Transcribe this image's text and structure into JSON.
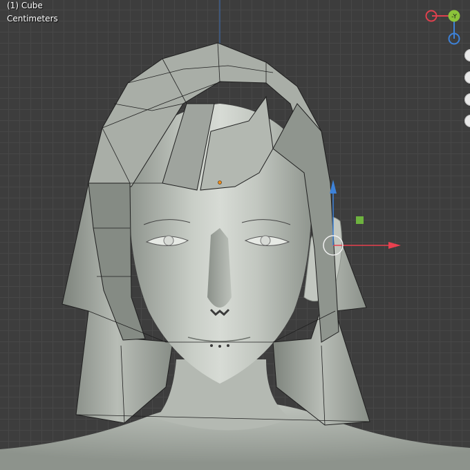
{
  "viewport": {
    "object_label": "(1) Cube",
    "units_label": "Centimeters"
  },
  "nav_gizmo": {
    "axis_labels": {
      "neg_y": "-Y"
    },
    "colors": {
      "x": "#e0414e",
      "y": "#8bc33a",
      "z": "#3d82d9"
    }
  },
  "transform_gizmo": {
    "colors": {
      "x": "#e8404f",
      "z": "#3d82d9",
      "plane": "#6eb33f"
    }
  },
  "side_tools": {
    "buttons": [
      "zoom-tool",
      "pan-tool",
      "camera-tool",
      "perspective-tool"
    ]
  },
  "colors": {
    "background": "#3d3d3d",
    "grid": "#474747",
    "mesh": "#a6aba5",
    "wire": "#1f1f1f",
    "origin": "#f28c18"
  }
}
